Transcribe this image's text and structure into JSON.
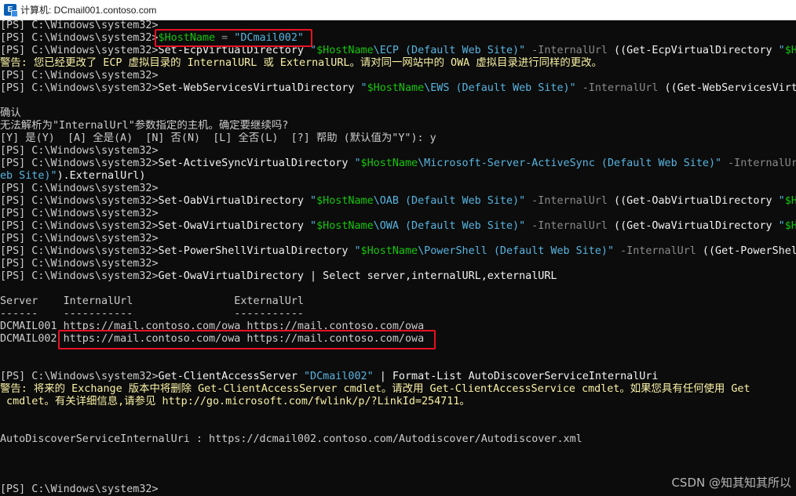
{
  "window": {
    "title": "计算机: DCmail001.contoso.com",
    "icon": "exchange-console-icon",
    "icon_glyph": "E"
  },
  "console": {
    "lines": [
      {
        "segs": [
          {
            "t": "[PS] C:\\Windows\\system32>",
            "c": "text"
          }
        ]
      },
      {
        "segs": [
          {
            "t": "[PS] C:\\Windows\\system32>",
            "c": "text"
          },
          {
            "t": "$HostName",
            "c": "var"
          },
          {
            "t": " = ",
            "c": "param"
          },
          {
            "t": "\"DCmail002\"",
            "c": "str"
          }
        ]
      },
      {
        "segs": [
          {
            "t": "[PS] C:\\Windows\\system32>",
            "c": "text"
          },
          {
            "t": "Set-EcpVirtualDirectory ",
            "c": "cmd"
          },
          {
            "t": "\"",
            "c": "str"
          },
          {
            "t": "$HostName",
            "c": "var"
          },
          {
            "t": "\\ECP (Default Web Site)\"",
            "c": "str"
          },
          {
            "t": " -InternalUrl ",
            "c": "param"
          },
          {
            "t": "((Get-EcpVirtualDirectory ",
            "c": "cmd"
          },
          {
            "t": "\"",
            "c": "str"
          },
          {
            "t": "$Ho",
            "c": "var"
          }
        ]
      },
      {
        "segs": [
          {
            "t": "警告: 您已经更改了 ECP 虚拟目录的 InternalURL 或 ExternalURL。请对同一网站中的 OWA 虚拟目录进行同样的更改。",
            "c": "warn"
          }
        ]
      },
      {
        "segs": [
          {
            "t": "[PS] C:\\Windows\\system32>",
            "c": "text"
          }
        ]
      },
      {
        "segs": [
          {
            "t": "[PS] C:\\Windows\\system32>",
            "c": "text"
          },
          {
            "t": "Set-WebServicesVirtualDirectory ",
            "c": "cmd"
          },
          {
            "t": "\"",
            "c": "str"
          },
          {
            "t": "$HostName",
            "c": "var"
          },
          {
            "t": "\\EWS (Default Web Site)\"",
            "c": "str"
          },
          {
            "t": " -InternalUrl ",
            "c": "param"
          },
          {
            "t": "((Get-WebServicesVirtu",
            "c": "cmd"
          }
        ]
      },
      {
        "segs": [
          {
            "t": "",
            "c": "text"
          }
        ]
      },
      {
        "segs": [
          {
            "t": "确认",
            "c": "text"
          }
        ]
      },
      {
        "segs": [
          {
            "t": "无法解析为\"InternalUrl\"参数指定的主机。确定要继续吗?",
            "c": "text"
          }
        ]
      },
      {
        "segs": [
          {
            "t": "[Y] 是(Y)  [A] 全是(A)  [N] 否(N)  [L] 全否(L)  [?] 帮助 (默认值为\"Y\"): y",
            "c": "text"
          }
        ]
      },
      {
        "segs": [
          {
            "t": "[PS] C:\\Windows\\system32>",
            "c": "text"
          }
        ]
      },
      {
        "segs": [
          {
            "t": "[PS] C:\\Windows\\system32>",
            "c": "text"
          },
          {
            "t": "Set-ActiveSyncVirtualDirectory ",
            "c": "cmd"
          },
          {
            "t": "\"",
            "c": "str"
          },
          {
            "t": "$HostName",
            "c": "var"
          },
          {
            "t": "\\Microsoft-Server-ActiveSync (Default Web Site)\"",
            "c": "str"
          },
          {
            "t": " -InternalUrl",
            "c": "param"
          }
        ]
      },
      {
        "segs": [
          {
            "t": "eb Site)\"",
            "c": "str"
          },
          {
            "t": ").ExternalUrl)",
            "c": "cmd"
          }
        ]
      },
      {
        "segs": [
          {
            "t": "[PS] C:\\Windows\\system32>",
            "c": "text"
          }
        ]
      },
      {
        "segs": [
          {
            "t": "[PS] C:\\Windows\\system32>",
            "c": "text"
          },
          {
            "t": "Set-OabVirtualDirectory ",
            "c": "cmd"
          },
          {
            "t": "\"",
            "c": "str"
          },
          {
            "t": "$HostName",
            "c": "var"
          },
          {
            "t": "\\OAB (Default Web Site)\"",
            "c": "str"
          },
          {
            "t": " -InternalUrl ",
            "c": "param"
          },
          {
            "t": "((Get-OabVirtualDirectory ",
            "c": "cmd"
          },
          {
            "t": "\"",
            "c": "str"
          },
          {
            "t": "$Ho",
            "c": "var"
          }
        ]
      },
      {
        "segs": [
          {
            "t": "[PS] C:\\Windows\\system32>",
            "c": "text"
          }
        ]
      },
      {
        "segs": [
          {
            "t": "[PS] C:\\Windows\\system32>",
            "c": "text"
          },
          {
            "t": "Set-OwaVirtualDirectory ",
            "c": "cmd"
          },
          {
            "t": "\"",
            "c": "str"
          },
          {
            "t": "$HostName",
            "c": "var"
          },
          {
            "t": "\\OWA (Default Web Site)\"",
            "c": "str"
          },
          {
            "t": " -InternalUrl ",
            "c": "param"
          },
          {
            "t": "((Get-OwaVirtualDirectory ",
            "c": "cmd"
          },
          {
            "t": "\"",
            "c": "str"
          },
          {
            "t": "$Ho",
            "c": "var"
          }
        ]
      },
      {
        "segs": [
          {
            "t": "[PS] C:\\Windows\\system32>",
            "c": "text"
          }
        ]
      },
      {
        "segs": [
          {
            "t": "[PS] C:\\Windows\\system32>",
            "c": "text"
          },
          {
            "t": "Set-PowerShellVirtualDirectory ",
            "c": "cmd"
          },
          {
            "t": "\"",
            "c": "str"
          },
          {
            "t": "$HostName",
            "c": "var"
          },
          {
            "t": "\\PowerShell (Default Web Site)\"",
            "c": "str"
          },
          {
            "t": " -InternalUrl ",
            "c": "param"
          },
          {
            "t": "((Get-PowerShell",
            "c": "cmd"
          }
        ]
      },
      {
        "segs": [
          {
            "t": "[PS] C:\\Windows\\system32>",
            "c": "text"
          }
        ]
      },
      {
        "segs": [
          {
            "t": "[PS] C:\\Windows\\system32>",
            "c": "text"
          },
          {
            "t": "Get-OwaVirtualDirectory | Select server,internalURL,externalURL",
            "c": "cmd"
          }
        ]
      },
      {
        "segs": [
          {
            "t": "",
            "c": "text"
          }
        ]
      },
      {
        "segs": [
          {
            "t": "Server    InternalUrl                ExternalUrl",
            "c": "text"
          }
        ]
      },
      {
        "segs": [
          {
            "t": "------    -----------                -----------",
            "c": "text"
          }
        ]
      },
      {
        "segs": [
          {
            "t": "DCMAIL001 https://mail.contoso.com/owa https://mail.contoso.com/owa",
            "c": "text"
          }
        ]
      },
      {
        "segs": [
          {
            "t": "DCMAIL002 https://mail.contoso.com/owa https://mail.contoso.com/owa",
            "c": "text"
          }
        ]
      },
      {
        "segs": [
          {
            "t": "",
            "c": "text"
          }
        ]
      },
      {
        "segs": [
          {
            "t": "",
            "c": "text"
          }
        ]
      },
      {
        "segs": [
          {
            "t": "[PS] C:\\Windows\\system32>",
            "c": "text"
          },
          {
            "t": "Get-ClientAccessServer ",
            "c": "cmd"
          },
          {
            "t": "\"DCmail002\"",
            "c": "str"
          },
          {
            "t": " | Format-List AutoDiscoverServiceInternalUri",
            "c": "cmd"
          }
        ]
      },
      {
        "segs": [
          {
            "t": "警告: 将来的 Exchange 版本中将删除 Get-ClientAccessServer cmdlet。请改用 Get-ClientAccessService cmdlet。如果您具有任何使用 Get",
            "c": "warn"
          }
        ]
      },
      {
        "segs": [
          {
            "t": " cmdlet。有关详细信息,请参见 http://go.microsoft.com/fwlink/p/?LinkId=254711。",
            "c": "warn"
          }
        ]
      },
      {
        "segs": [
          {
            "t": "",
            "c": "text"
          }
        ]
      },
      {
        "segs": [
          {
            "t": "",
            "c": "text"
          }
        ]
      },
      {
        "segs": [
          {
            "t": "AutoDiscoverServiceInternalUri : https://dcmail002.contoso.com/Autodiscover/Autodiscover.xml",
            "c": "text"
          }
        ]
      },
      {
        "segs": [
          {
            "t": "",
            "c": "text"
          }
        ]
      },
      {
        "segs": [
          {
            "t": "",
            "c": "text"
          }
        ]
      },
      {
        "segs": [
          {
            "t": "",
            "c": "text"
          }
        ]
      },
      {
        "segs": [
          {
            "t": "[PS] C:\\Windows\\system32>",
            "c": "text"
          }
        ]
      }
    ]
  },
  "watermark": "CSDN @知其知其所以"
}
